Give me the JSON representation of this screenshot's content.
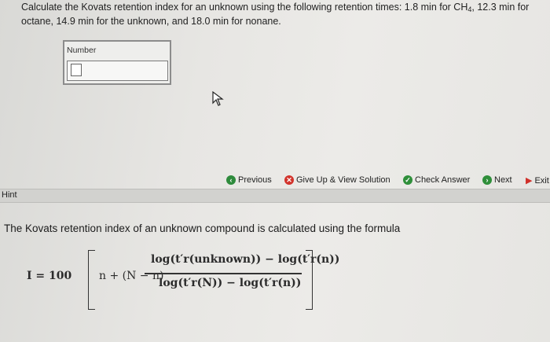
{
  "question": {
    "part1": "Calculate the Kovats retention index for an unknown using the following retention times: 1.8 min for CH",
    "sub": "4",
    "part2": ", 12.3 min for octane, 14.9 min for the unknown, and 18.0 min for nonane."
  },
  "answer": {
    "label": "Number",
    "value": ""
  },
  "toolbar": {
    "previous": "Previous",
    "give_up": "Give Up & View Solution",
    "check": "Check Answer",
    "next": "Next",
    "exit": "Exit"
  },
  "hint": {
    "label": "Hint",
    "text": "The Kovats retention index of an unknown compound is calculated using the formula"
  },
  "formula": {
    "lhs": "I = 100",
    "mid": "n + (N − n)",
    "numerator": "log(t′r(unknown)) − log(t′r(n))",
    "denominator": "log(t′r(N)) − log(t′r(n))"
  },
  "colors": {
    "previous_icon": "#2e8b3c",
    "giveup_icon": "#d2342c",
    "check_icon": "#2f8f3a",
    "next_icon": "#2f8f3a",
    "exit_icon": "#d0302a"
  }
}
